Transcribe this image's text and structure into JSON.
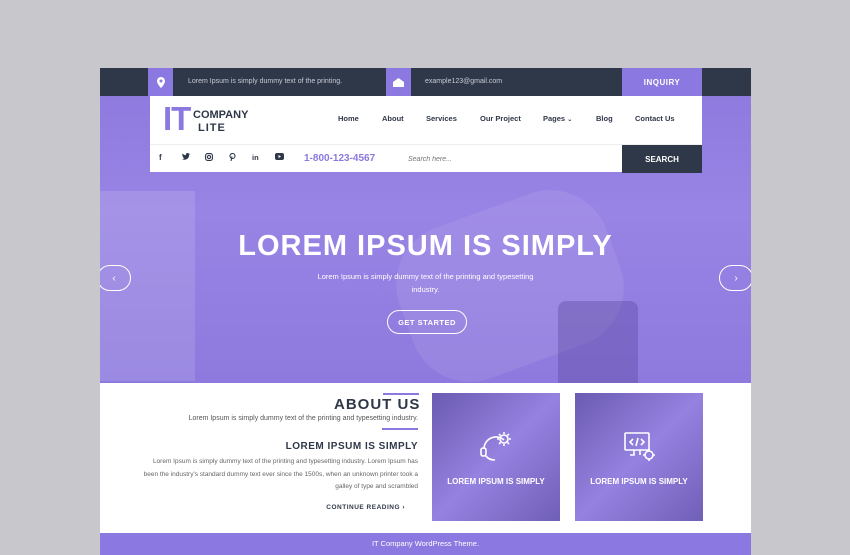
{
  "topbar": {
    "address": "Lorem Ipsum is simply dummy text of the printing.",
    "email": "example123@gmail.com",
    "inquiry_label": "INQUIRY"
  },
  "logo": {
    "it": "IT",
    "company": "COMPANY",
    "lite": "LITE"
  },
  "nav": {
    "items": [
      "Home",
      "About",
      "Services",
      "Our Project",
      "Pages",
      "Blog",
      "Contact Us"
    ]
  },
  "social": {
    "icons": [
      "facebook-icon",
      "twitter-icon",
      "instagram-icon",
      "pinterest-icon",
      "linkedin-icon",
      "youtube-icon"
    ]
  },
  "phone": "1-800-123-4567",
  "search": {
    "placeholder": "Search here...",
    "button_label": "SEARCH"
  },
  "hero": {
    "title": "LOREM IPSUM IS SIMPLY",
    "subtitle": "Lorem Ipsum is simply dummy text of the printing and typesetting industry.",
    "button_label": "GET STARTED",
    "prev": "‹",
    "next": "›"
  },
  "about": {
    "title": "ABOUT US",
    "subtitle": "Lorem Ipsum is simply dummy text of the printing and typesetting industry.",
    "heading": "LOREM IPSUM IS SIMPLY",
    "paragraph": "Lorem Ipsum is simply dummy text of the printing and typesetting industry. Lorem Ipsum has been the industry's standard dummy text ever since the 1500s, when an unknown printer took a galley of type and scrambled",
    "continue_label": "CONTINUE READING  ›"
  },
  "cards": [
    {
      "label": "LOREM IPSUM IS SIMPLY",
      "icon": "support-gear-icon"
    },
    {
      "label": "LOREM IPSUM IS SIMPLY",
      "icon": "code-monitor-icon"
    }
  ],
  "footer": {
    "text": "IT Company WordPress Theme."
  },
  "colors": {
    "accent": "#8b78e0",
    "dark": "#2f3848"
  }
}
